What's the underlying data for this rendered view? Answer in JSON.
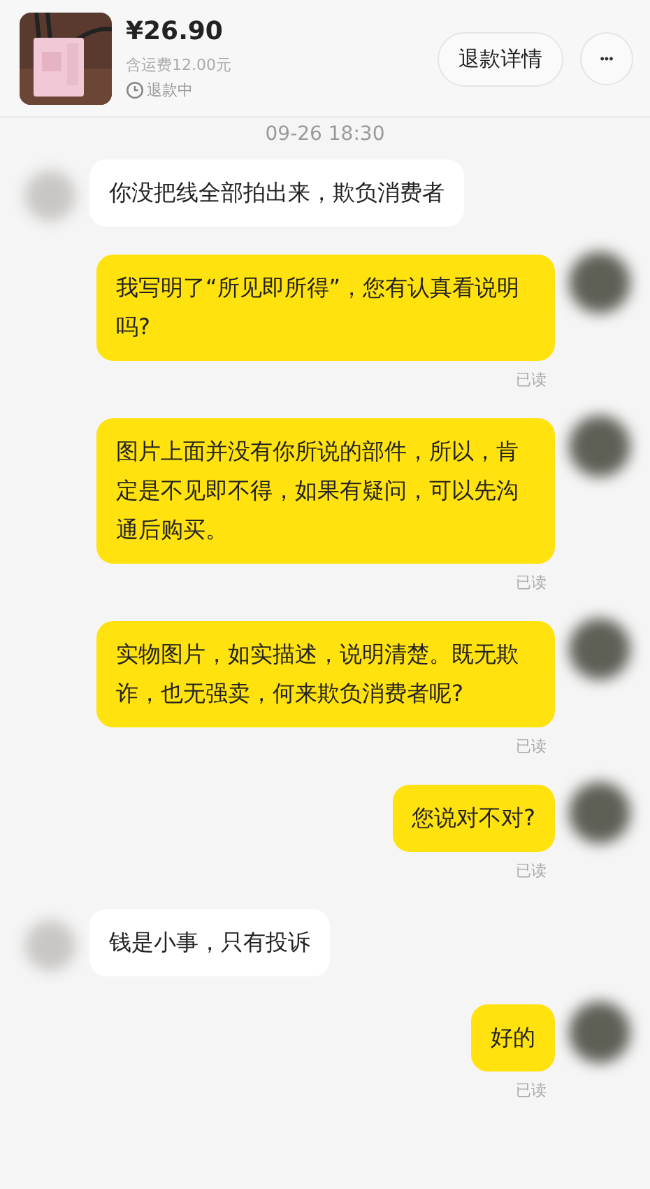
{
  "order": {
    "price": "¥26.90",
    "shipping": "含运费12.00元",
    "status": "退款中",
    "detail_button": "退款详情",
    "more_button": "•••"
  },
  "timestamp": "09-26 18:30",
  "messages": [
    {
      "kind": "received",
      "text": "你没把线全部拍出来，欺负消费者"
    },
    {
      "kind": "sent",
      "text": "我写明了“所见即所得”，您有认真看说明吗?",
      "read": "已读"
    },
    {
      "kind": "sent",
      "text": "图片上面并没有你所说的部件，所以，肯定是不见即不得，如果有疑问，可以先沟通后购买。",
      "read": "已读"
    },
    {
      "kind": "sent",
      "text": "实物图片，如实描述，说明清楚。既无欺诈，也无强卖，何来欺负消费者呢?",
      "read": "已读"
    },
    {
      "kind": "sent",
      "text": "您说对不对?",
      "read": "已读"
    },
    {
      "kind": "received",
      "text": "钱是小事，只有投诉"
    },
    {
      "kind": "sent",
      "text": "好的",
      "read": "已读"
    }
  ]
}
